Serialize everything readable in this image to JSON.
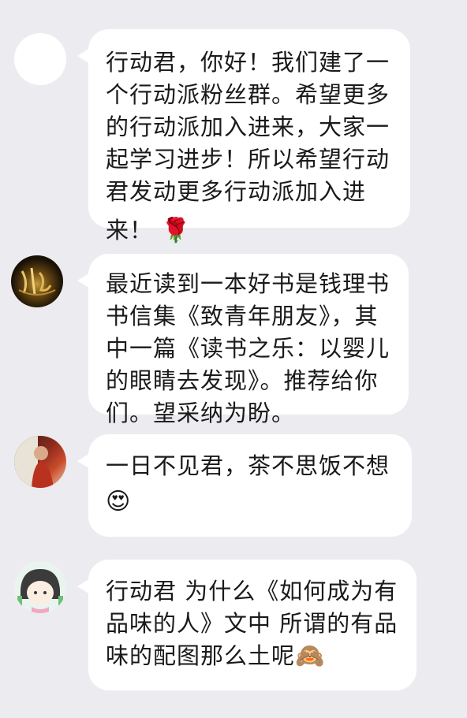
{
  "messages": [
    {
      "text_lines": [
        "行动君，你好！我们建了一",
        "个行动派粉丝群。希望更多",
        "的行动派加入进来，大家一",
        "起学习进步！所以希望行动",
        "君发动更多行动派加入进",
        "来！"
      ],
      "emoji": "🌹",
      "emoji_name": "rose-icon"
    },
    {
      "text_lines": [
        "最近读到一本好书是钱理书",
        "书信集《致青年朋友》，其",
        "中一篇《读书之乐：以婴儿",
        "的眼睛去发现》。推荐给你",
        "们。望采纳为盼。"
      ],
      "emoji": "",
      "emoji_name": ""
    },
    {
      "text_lines": [
        "一日不见君，茶不思饭不想"
      ],
      "emoji": "😍",
      "emoji_name": "heart-eyes-icon"
    },
    {
      "text_lines": [
        "行动君 为什么《如何成为有",
        "品味的人》文中 所谓的有品",
        "味的配图那么土呢"
      ],
      "emoji": "🙈",
      "emoji_name": "see-no-evil-monkey-icon"
    }
  ],
  "colors": {
    "background": "#ececf0",
    "bubble": "#ffffff",
    "text": "#1a1a1a"
  }
}
